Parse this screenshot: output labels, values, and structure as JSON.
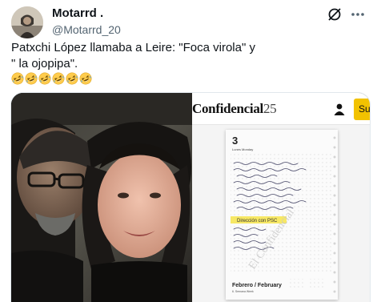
{
  "author": {
    "display_name": "Motarrd .",
    "handle": "@Motarrd_20"
  },
  "tweet": {
    "line1": "Patxchi López llamaba a Leire: \"Foca virola\" y",
    "line2": "\" la ojopipa\".",
    "emoji_count": 6,
    "emoji_name": "rolling-on-floor-laughing-emoji"
  },
  "media": {
    "left_photo": "selfie-photo",
    "right_screenshot": {
      "logo_text": "Confidencial",
      "logo_number": "25",
      "subscribe_label": "Sus",
      "agenda": {
        "day_number": "3",
        "day_name": "Lunes Monday",
        "footer_month": "Febrero / February",
        "footer_week": "6. Semana Week",
        "watermark": "El Confidencial",
        "highlighted_note": "Dirección con PSC"
      }
    }
  },
  "colors": {
    "text_primary": "#0f1419",
    "text_secondary": "#536471",
    "subscribe_yellow": "#f2c200",
    "highlighter": "#f6e44a"
  },
  "icons": {
    "grok": "grok-icon",
    "more": "more-options-icon",
    "user": "user-icon"
  }
}
